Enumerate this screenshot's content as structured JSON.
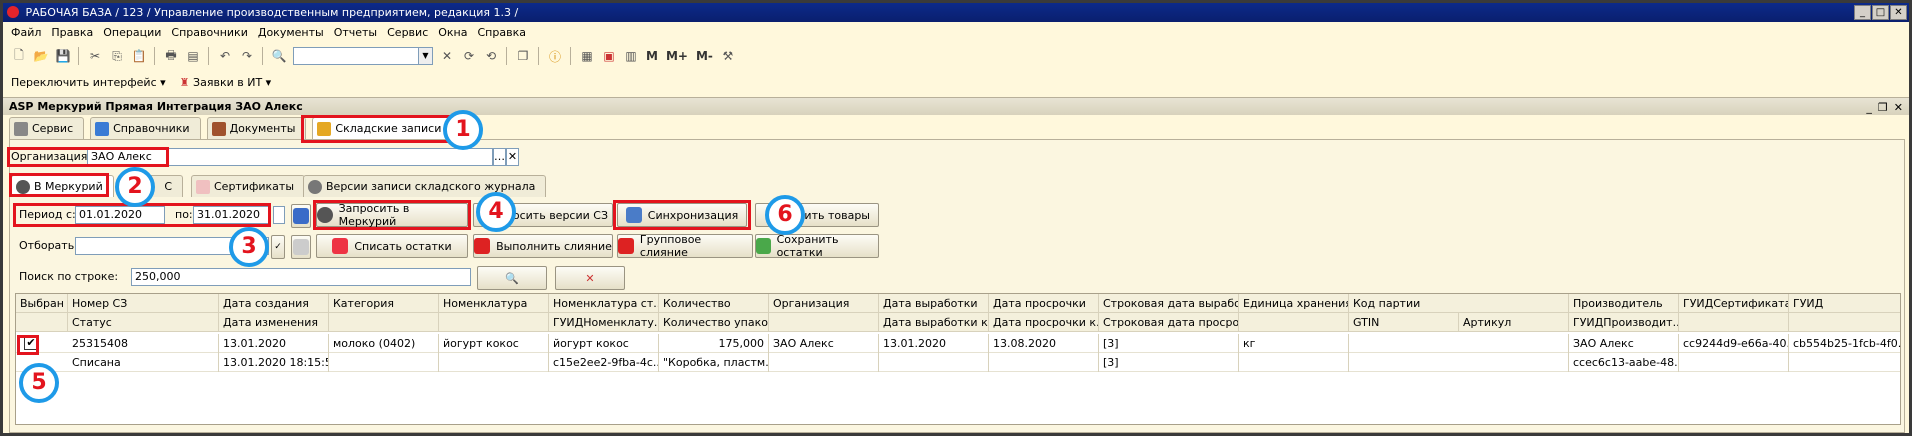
{
  "window": {
    "title": "РАБОЧАЯ БАЗА / 123 / Управление производственным предприятием, редакция 1.3 /"
  },
  "menu": [
    "Файл",
    "Правка",
    "Операции",
    "Справочники",
    "Документы",
    "Отчеты",
    "Сервис",
    "Окна",
    "Справка"
  ],
  "toolbar": {
    "m": "M",
    "mplus": "M+",
    "mminus": "M-"
  },
  "toolbar2": {
    "switch_interface": "Переключить интерфейс",
    "requests": "Заявки в ИТ"
  },
  "subwindow": {
    "title": "ASP Меркурий Прямая Интеграция ЗАО Алекс"
  },
  "tabs": [
    {
      "label": "Сервис"
    },
    {
      "label": "Справочники"
    },
    {
      "label": "Документы"
    },
    {
      "label": "Складские записи"
    }
  ],
  "org": {
    "label": "Организация:",
    "value": "ЗАО Алекс"
  },
  "subtabs": [
    {
      "label": "В Меркурий"
    },
    {
      "label": "С"
    },
    {
      "label": "Сертификаты"
    },
    {
      "label": "Версии записи складского журнала"
    }
  ],
  "period": {
    "from_label": "Период с:",
    "from": "01.01.2020",
    "to_label": "по:",
    "to": "31.01.2020"
  },
  "filter": {
    "label": "Отборать:"
  },
  "search": {
    "label": "Поиск по строке:",
    "value": "250,000"
  },
  "buttons": {
    "request_mercury": "Запросить в Меркурий",
    "request_versions": "Запросить версии СЗ",
    "sync": "Синхронизация",
    "load_goods": "узить товары",
    "write_off": "Списать остатки",
    "merge": "Выполнить слияние",
    "group_merge": "Групповое слияние",
    "save_rest": "Сохранить остатки"
  },
  "markers": [
    "1",
    "2",
    "3",
    "4",
    "5",
    "6"
  ],
  "grid": {
    "header1": [
      "Выбран",
      "Номер СЗ",
      "Дата создания",
      "Категория",
      "Номенклатура",
      "Номенклатура ст...",
      "Количество",
      "Организация",
      "Дата выработки",
      "Дата просрочки",
      "Строковая дата выработ...",
      "Единица хранения",
      "Код партии",
      "",
      "Производитель",
      "ГУИДСертификата",
      "ГУИД"
    ],
    "header2": [
      "",
      "Статус",
      "Дата изменения",
      "",
      "",
      "ГУИДНоменклату...",
      "Количество упако...",
      "",
      "Дата выработки к...",
      "Дата просрочки к...",
      "Строковая дата просроч...",
      "",
      "GTIN",
      "Артикул",
      "ГУИДПроизводит...",
      "",
      ""
    ],
    "row1": [
      "",
      "25315408",
      "13.01.2020",
      "молоко (0402)",
      "йогурт кокос",
      "йогурт кокос",
      "175,000",
      "ЗАО Алекс",
      "13.01.2020",
      "13.08.2020",
      "[3]",
      "кг",
      "",
      "",
      "ЗАО Алекс",
      "cc9244d9-e66a-40...",
      "cb554b25-1fcb-4f0..."
    ],
    "row2": [
      "",
      "Списана",
      "13.01.2020 18:15:55",
      "",
      "",
      "c15e2ee2-9fba-4c...",
      "\"Коробка, пластм...",
      "",
      "",
      "",
      "[3]",
      "",
      "",
      "",
      "ccec6c13-aabe-48...",
      "",
      ""
    ],
    "checked": "✔"
  },
  "colors": {
    "highlight": "#e3141e",
    "marker_ring": "#1e9ae8",
    "title_bg": "#0c2a8a"
  }
}
